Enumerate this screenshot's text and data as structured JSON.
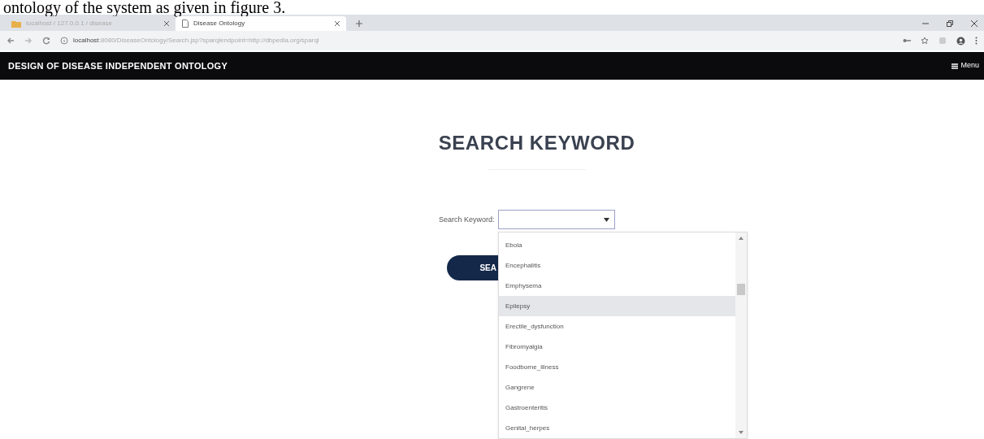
{
  "caption": "ontology of the system as given in figure 3.",
  "browser": {
    "tabs": [
      {
        "title": "localhost / 127.0.0.1 / disease",
        "selected": false
      },
      {
        "title": "Disease Ontology",
        "selected": true
      }
    ],
    "url_host": "localhost",
    "url_rest": ":8080/DiseaseOntology/Search.jsp?sparqlendpoint=http://dbpedia.org/sparql"
  },
  "navbar": {
    "title": "DESIGN OF DISEASE INDEPENDENT ONTOLOGY",
    "menu": "Menu"
  },
  "heading": "SEARCH KEYWORD",
  "form": {
    "label": "Search Keyword:",
    "button": "SEA"
  },
  "dropdown": {
    "options": [
      {
        "label": "Ebola",
        "selected": false
      },
      {
        "label": "Encephalitis",
        "selected": false
      },
      {
        "label": "Emphysema",
        "selected": false
      },
      {
        "label": "Epilepsy",
        "selected": true
      },
      {
        "label": "Erectile_dysfunction",
        "selected": false
      },
      {
        "label": "Fibromyalgia",
        "selected": false
      },
      {
        "label": "Foodborne_illness",
        "selected": false
      },
      {
        "label": "Gangrene",
        "selected": false
      },
      {
        "label": "Gastroenteritis",
        "selected": false
      },
      {
        "label": "Genital_herpes",
        "selected": false
      }
    ]
  }
}
